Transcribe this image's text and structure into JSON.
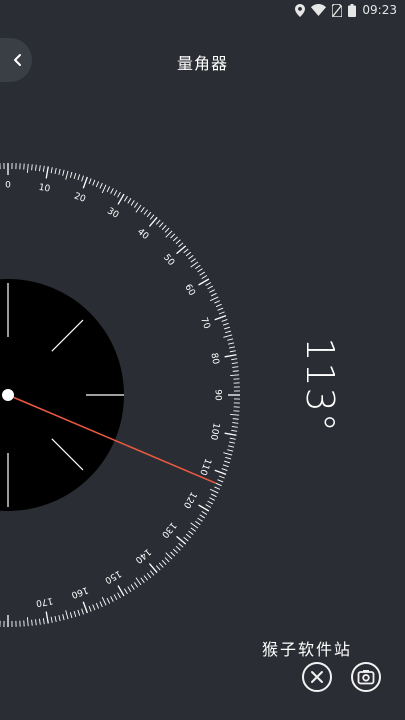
{
  "status": {
    "time": "09:23"
  },
  "header": {
    "title": "量角器"
  },
  "protractor": {
    "angle_value": 113,
    "angle_display": "113°",
    "scale_labels": [
      "0",
      "10",
      "20",
      "30",
      "40",
      "50",
      "60",
      "70",
      "80",
      "90",
      "100",
      "110",
      "120",
      "130",
      "140",
      "150",
      "160",
      "170"
    ],
    "needle_color": "#e8593f",
    "scale_color": "#ffffff"
  },
  "watermark": "猴子软件站",
  "icons": {
    "back": "chevron-left-icon",
    "close": "close-icon",
    "camera": "camera-switch-icon"
  }
}
